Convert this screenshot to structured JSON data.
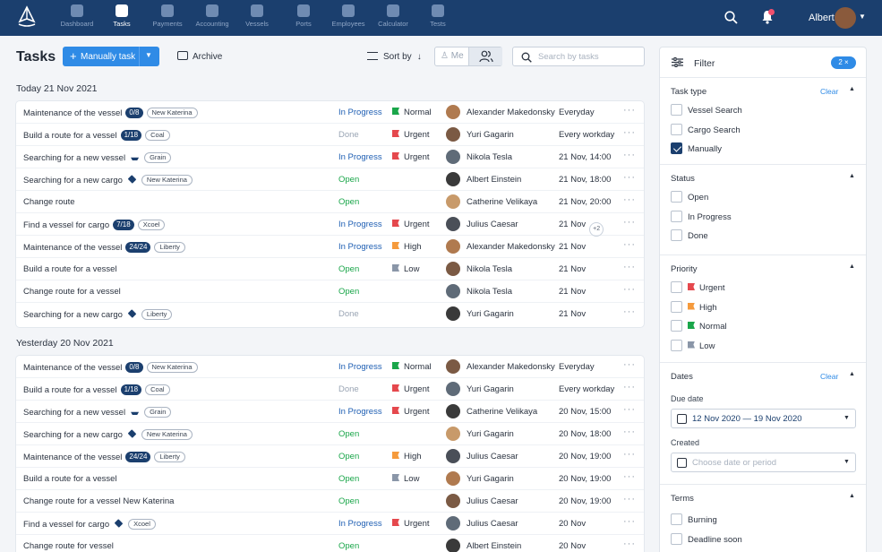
{
  "nav": {
    "items": [
      {
        "label": "Dashboard",
        "active": false
      },
      {
        "label": "Tasks",
        "active": true
      },
      {
        "label": "Payments",
        "active": false
      },
      {
        "label": "Accounting",
        "active": false
      },
      {
        "label": "Vessels",
        "active": false
      },
      {
        "label": "Ports",
        "active": false
      },
      {
        "label": "Employees",
        "active": false
      },
      {
        "label": "Calculator",
        "active": false
      },
      {
        "label": "Tests",
        "active": false
      }
    ],
    "user_name": "Albert"
  },
  "toolbar": {
    "title": "Tasks",
    "add_label": "Manually task",
    "archive_label": "Archive",
    "sort_label": "Sort by",
    "me_label": "Me",
    "search_placeholder": "Search by tasks"
  },
  "groups": [
    {
      "title": "Today 21 Nov 2021",
      "rows": [
        {
          "task": "Maintenance of the vessel",
          "count": "0/8",
          "icon": "",
          "tag": "New Katerina",
          "status": "In Progress",
          "priority": "Normal",
          "person": "Alexander Makedonsky",
          "due": "Everyday",
          "extra": ""
        },
        {
          "task": "Build a route for a vessel",
          "count": "1/18",
          "icon": "",
          "tag": "Coal",
          "status": "Done",
          "priority": "Urgent",
          "person": "Yuri Gagarin",
          "due": "Every workday",
          "extra": ""
        },
        {
          "task": "Searching for a new vessel",
          "count": "",
          "icon": "ship-icon",
          "tag": "Grain",
          "status": "In Progress",
          "priority": "Urgent",
          "person": "Nikola Tesla",
          "due": "21 Nov, 14:00",
          "extra": ""
        },
        {
          "task": "Searching for a new cargo",
          "count": "",
          "icon": "cube-icon",
          "tag": "New Katerina",
          "status": "Open",
          "priority": "",
          "person": "Albert Einstein",
          "due": "21 Nov, 18:00",
          "extra": ""
        },
        {
          "task": "Change route",
          "count": "",
          "icon": "",
          "tag": "",
          "status": "Open",
          "priority": "",
          "person": "Catherine Velikaya",
          "due": "21 Nov, 20:00",
          "extra": ""
        },
        {
          "task": "Find a vessel for cargo",
          "count": "7/18",
          "icon": "",
          "tag": "Xcoel",
          "status": "In Progress",
          "priority": "Urgent",
          "person": "Julius Caesar",
          "due": "21 Nov",
          "extra": "+2"
        },
        {
          "task": "Maintenance of the vessel",
          "count": "24/24",
          "icon": "",
          "tag": "Liberty",
          "status": "In Progress",
          "priority": "High",
          "person": "Alexander Makedonsky",
          "due": "21 Nov",
          "extra": ""
        },
        {
          "task": "Build a route for a vessel",
          "count": "",
          "icon": "",
          "tag": "",
          "status": "Open",
          "priority": "Low",
          "person": "Nikola Tesla",
          "due": "21 Nov",
          "extra": ""
        },
        {
          "task": "Change route for a vessel",
          "count": "",
          "icon": "",
          "tag": "",
          "status": "Open",
          "priority": "",
          "person": "Nikola Tesla",
          "due": "21 Nov",
          "extra": ""
        },
        {
          "task": "Searching for a new cargo",
          "count": "",
          "icon": "cube-icon",
          "tag": "Liberty",
          "status": "Done",
          "priority": "",
          "person": "Yuri Gagarin",
          "due": "21 Nov",
          "extra": ""
        }
      ]
    },
    {
      "title": "Yesterday 20 Nov 2021",
      "rows": [
        {
          "task": "Maintenance of the vessel",
          "count": "0/8",
          "icon": "",
          "tag": "New Katerina",
          "status": "In Progress",
          "priority": "Normal",
          "person": "Alexander Makedonsky",
          "due": "Everyday",
          "extra": ""
        },
        {
          "task": "Build a route for a vessel",
          "count": "1/18",
          "icon": "",
          "tag": "Coal",
          "status": "Done",
          "priority": "Urgent",
          "person": "Yuri Gagarin",
          "due": "Every workday",
          "extra": ""
        },
        {
          "task": "Searching for a new vessel",
          "count": "",
          "icon": "ship-icon",
          "tag": "Grain",
          "status": "In Progress",
          "priority": "Urgent",
          "person": "Catherine Velikaya",
          "due": "20 Nov, 15:00",
          "extra": ""
        },
        {
          "task": "Searching for a new cargo",
          "count": "",
          "icon": "cube-icon",
          "tag": "New Katerina",
          "status": "Open",
          "priority": "",
          "person": "Yuri Gagarin",
          "due": "20 Nov, 18:00",
          "extra": ""
        },
        {
          "task": "Maintenance of the vessel",
          "count": "24/24",
          "icon": "",
          "tag": "Liberty",
          "status": "Open",
          "priority": "High",
          "person": "Julius Caesar",
          "due": "20 Nov, 19:00",
          "extra": ""
        },
        {
          "task": "Build a route for a vessel",
          "count": "",
          "icon": "",
          "tag": "",
          "status": "Open",
          "priority": "Low",
          "person": "Yuri Gagarin",
          "due": "20 Nov, 19:00",
          "extra": ""
        },
        {
          "task": "Change route for a vessel New Katerina",
          "count": "",
          "icon": "",
          "tag": "",
          "status": "Open",
          "priority": "",
          "person": "Julius Caesar",
          "due": "20 Nov, 19:00",
          "extra": ""
        },
        {
          "task": "Find a vessel for cargo",
          "count": "",
          "icon": "cube-icon",
          "tag": "Xcoel",
          "status": "In Progress",
          "priority": "Urgent",
          "person": "Julius Caesar",
          "due": "20 Nov",
          "extra": ""
        },
        {
          "task": "Change route for vessel",
          "count": "",
          "icon": "",
          "tag": "",
          "status": "Open",
          "priority": "",
          "person": "Albert Einstein",
          "due": "20 Nov",
          "extra": ""
        }
      ]
    }
  ],
  "filter": {
    "title": "Filter",
    "count_label": "2 ×",
    "clear_label": "Clear",
    "task_type": {
      "title": "Task type",
      "options": [
        {
          "label": "Vessel Search",
          "checked": false
        },
        {
          "label": "Cargo Search",
          "checked": false
        },
        {
          "label": "Manually",
          "checked": true
        }
      ]
    },
    "status": {
      "title": "Status",
      "options": [
        {
          "label": "Open",
          "checked": false
        },
        {
          "label": "In Progress",
          "checked": false
        },
        {
          "label": "Done",
          "checked": false
        }
      ]
    },
    "priority": {
      "title": "Priority",
      "options": [
        {
          "label": "Urgent",
          "checked": false
        },
        {
          "label": "High",
          "checked": false
        },
        {
          "label": "Normal",
          "checked": false
        },
        {
          "label": "Low",
          "checked": false
        }
      ]
    },
    "dates": {
      "title": "Dates",
      "due_label": "Due date",
      "due_value": "12 Nov 2020 — 19 Nov 2020",
      "created_label": "Created",
      "created_placeholder": "Choose date or period"
    },
    "terms": {
      "title": "Terms",
      "options": [
        {
          "label": "Burning",
          "checked": false
        },
        {
          "label": "Deadline soon",
          "checked": false
        }
      ]
    }
  },
  "colors": {
    "navbar": "#1b3f6e",
    "primary": "#2f8be6",
    "status_in_progress": "#1f5fb3",
    "status_open": "#1aa64a",
    "status_done": "#9aa5b4",
    "priority_urgent": "#e5484d",
    "priority_high": "#f59a3c",
    "priority_normal": "#1aa64a",
    "priority_low": "#8a96a8"
  }
}
